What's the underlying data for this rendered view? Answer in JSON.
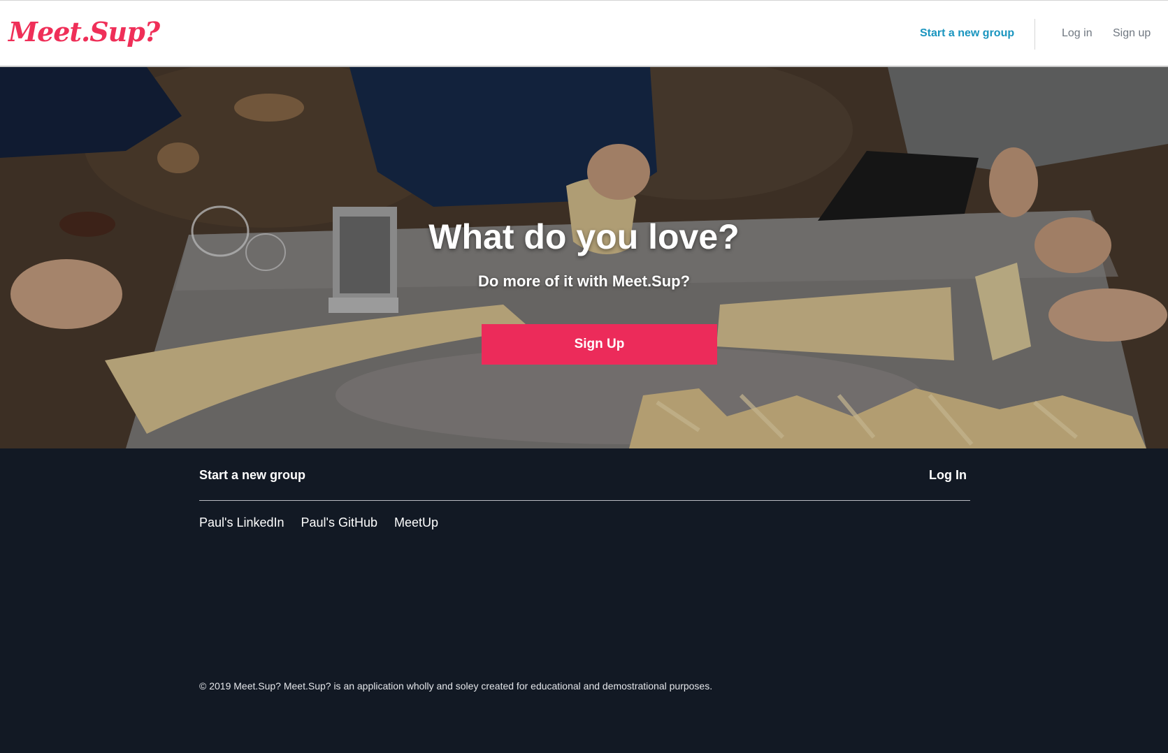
{
  "header": {
    "logo": "Meet.Sup?",
    "nav": {
      "start_group": "Start a new group",
      "log_in": "Log in",
      "sign_up": "Sign up"
    },
    "colors": {
      "brand": "#ef2f58",
      "link": "#1a95bf",
      "muted": "#6f7780"
    }
  },
  "hero": {
    "title": "What do you love?",
    "subtitle": "Do more of it with Meet.Sup?",
    "cta": "Sign Up",
    "colors": {
      "cta": "#ec2b5a"
    }
  },
  "footer": {
    "start_group": "Start a new group",
    "log_in": "Log In",
    "links": [
      "Paul's LinkedIn",
      "Paul's GitHub",
      "MeetUp"
    ],
    "copyright": "© 2019 Meet.Sup? Meet.Sup? is an application wholly and soley created for educational and demostrational purposes.",
    "colors": {
      "background": "#121924"
    }
  }
}
